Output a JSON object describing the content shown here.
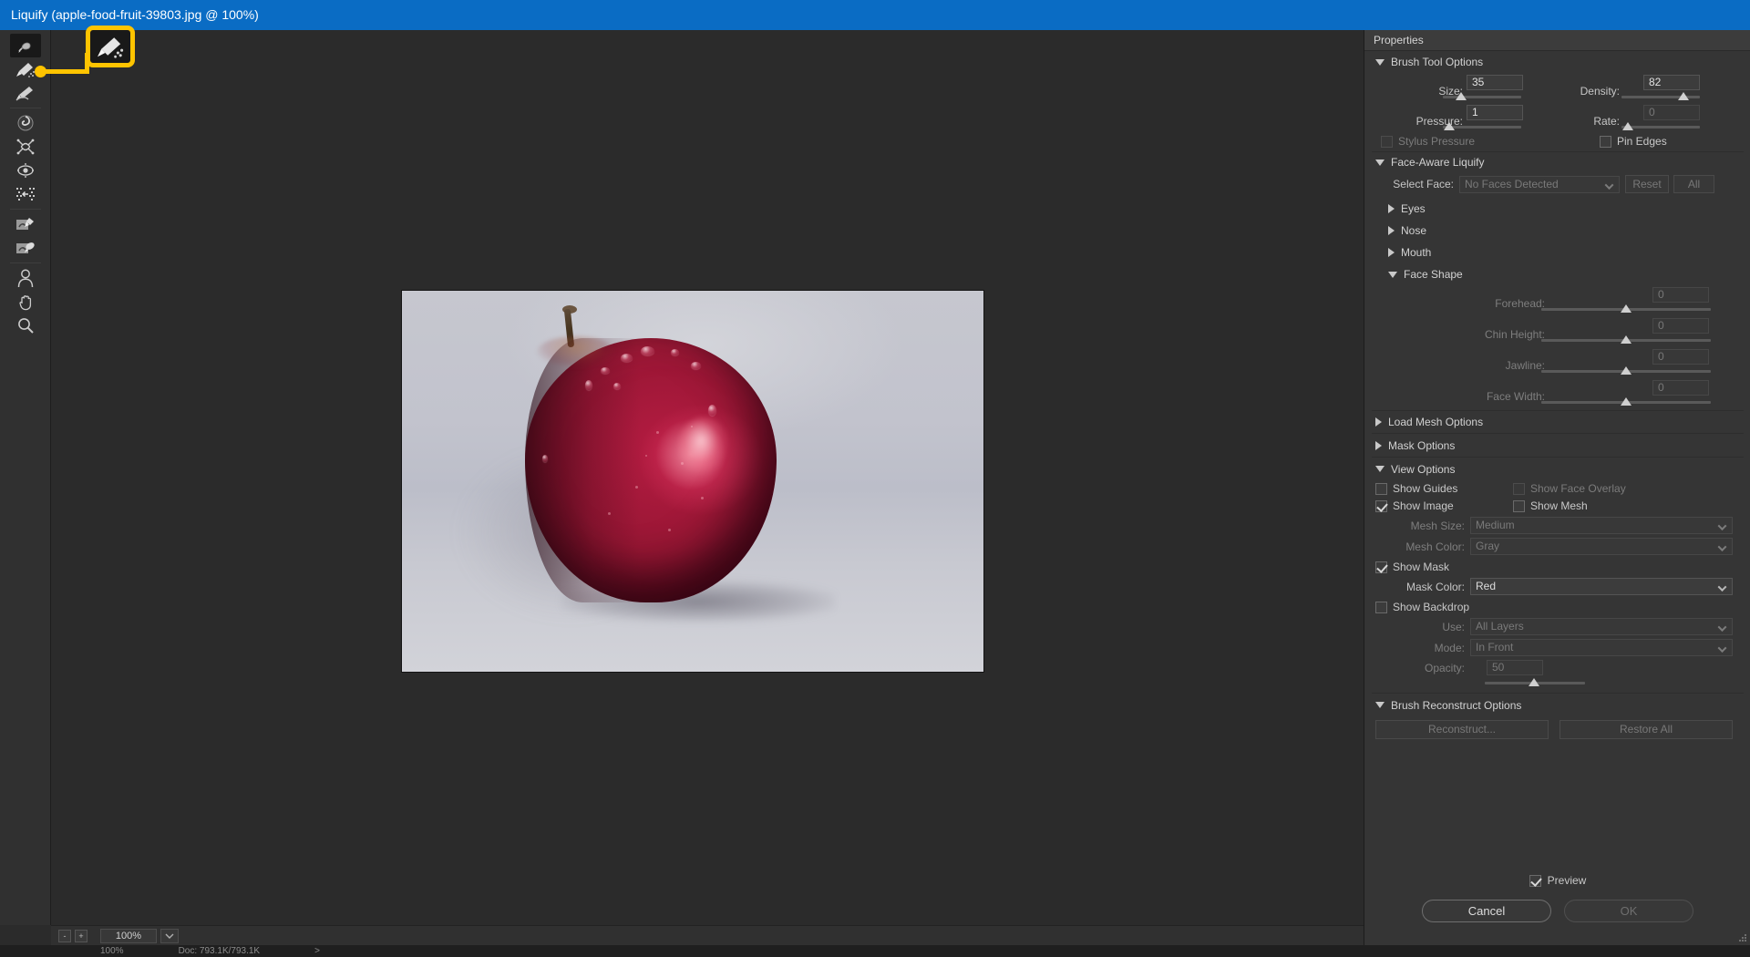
{
  "window": {
    "title": "Liquify (apple-food-fruit-39803.jpg @ 100%)"
  },
  "toolbar": {
    "tools": [
      {
        "name": "forward-warp-tool",
        "selected": true
      },
      {
        "name": "reconstruct-tool",
        "selected": false
      },
      {
        "name": "smooth-tool",
        "selected": false
      },
      {
        "name": "twirl-clockwise-tool",
        "selected": false
      },
      {
        "name": "pucker-tool",
        "selected": false
      },
      {
        "name": "bloat-tool",
        "selected": false
      },
      {
        "name": "push-left-tool",
        "selected": false
      },
      {
        "name": "freeze-mask-tool",
        "selected": false
      },
      {
        "name": "thaw-mask-tool",
        "selected": false
      },
      {
        "name": "face-tool",
        "selected": false
      },
      {
        "name": "hand-tool",
        "selected": false
      },
      {
        "name": "zoom-tool",
        "selected": false
      }
    ]
  },
  "annotation": {
    "target_tool": "reconstruct-tool",
    "color": "#ffc400"
  },
  "canvas": {
    "zoom_out_label": "-",
    "zoom_in_label": "+",
    "zoom_value": "100%",
    "image_alt": "red apple with water droplets on gray background"
  },
  "ps_status": {
    "zoom": "100%",
    "doc": "Doc: 793.1K/793.1K",
    "arrow": ">"
  },
  "properties": {
    "title": "Properties",
    "brush_tool_options": {
      "title": "Brush Tool Options",
      "size_label": "Size:",
      "size_value": "35",
      "density_label": "Density:",
      "density_value": "82",
      "pressure_label": "Pressure:",
      "pressure_value": "1",
      "rate_label": "Rate:",
      "rate_value": "0",
      "stylus_pressure_label": "Stylus Pressure",
      "pin_edges_label": "Pin Edges"
    },
    "face_aware": {
      "title": "Face-Aware Liquify",
      "select_face_label": "Select Face:",
      "select_face_value": "No Faces Detected",
      "reset_label": "Reset",
      "all_label": "All",
      "eyes_label": "Eyes",
      "nose_label": "Nose",
      "mouth_label": "Mouth",
      "face_shape_label": "Face Shape",
      "forehead_label": "Forehead:",
      "forehead_value": "0",
      "chin_height_label": "Chin Height:",
      "chin_height_value": "0",
      "jawline_label": "Jawline:",
      "jawline_value": "0",
      "face_width_label": "Face Width:",
      "face_width_value": "0"
    },
    "load_mesh_options": {
      "title": "Load Mesh Options"
    },
    "mask_options": {
      "title": "Mask Options"
    },
    "view_options": {
      "title": "View Options",
      "show_guides_label": "Show Guides",
      "show_face_overlay_label": "Show Face Overlay",
      "show_image_label": "Show Image",
      "show_mesh_label": "Show Mesh",
      "mesh_size_label": "Mesh Size:",
      "mesh_size_value": "Medium",
      "mesh_color_label": "Mesh Color:",
      "mesh_color_value": "Gray",
      "show_mask_label": "Show Mask",
      "mask_color_label": "Mask Color:",
      "mask_color_value": "Red",
      "show_backdrop_label": "Show Backdrop",
      "use_label": "Use:",
      "use_value": "All Layers",
      "mode_label": "Mode:",
      "mode_value": "In Front",
      "opacity_label": "Opacity:",
      "opacity_value": "50"
    },
    "brush_reconstruct": {
      "title": "Brush Reconstruct Options",
      "reconstruct_label": "Reconstruct...",
      "restore_all_label": "Restore All"
    },
    "footer": {
      "preview_label": "Preview",
      "cancel_label": "Cancel",
      "ok_label": "OK"
    }
  }
}
